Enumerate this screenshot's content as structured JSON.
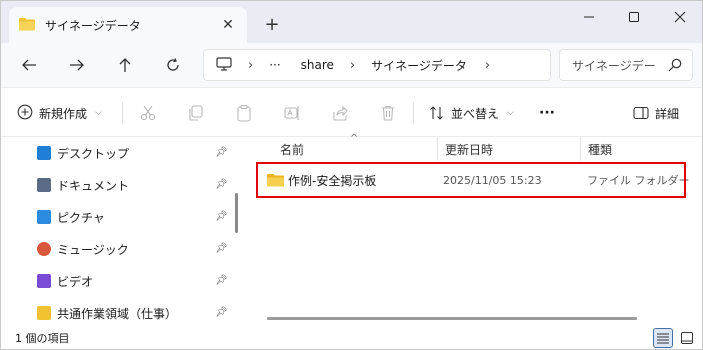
{
  "tab": {
    "title": "サイネージデータ",
    "close": "✕",
    "new_tab": "+"
  },
  "window_controls": {
    "minimize": "—",
    "maximize": "☐",
    "close": "✕"
  },
  "address": {
    "ellipsis": "···",
    "crumbs": [
      "share",
      "サイネージデータ"
    ]
  },
  "search": {
    "placeholder": "サイネージデー"
  },
  "commands": {
    "new_label": "新規作成",
    "sort_label": "並べ替え",
    "more": "···",
    "details_label": "詳細"
  },
  "sidebar": {
    "items": [
      {
        "label": "デスクトップ",
        "icon": "desktop-icon",
        "color": "#1f7fd6"
      },
      {
        "label": "ドキュメント",
        "icon": "document-icon",
        "color": "#5b6b85"
      },
      {
        "label": "ピクチャ",
        "icon": "picture-icon",
        "color": "#2b8be0"
      },
      {
        "label": "ミュージック",
        "icon": "music-icon",
        "color": "#d9573b"
      },
      {
        "label": "ビデオ",
        "icon": "video-icon",
        "color": "#7a4bd6"
      },
      {
        "label": "共通作業領域（仕事）",
        "icon": "folder-icon",
        "color": "#f2c230"
      }
    ]
  },
  "columns": {
    "name": "名前",
    "modified": "更新日時",
    "type": "種類"
  },
  "files": [
    {
      "name": "作例-安全掲示板",
      "modified": "2025/11/05 15:23",
      "type": "ファイル フォルダー"
    }
  ],
  "status": {
    "count_text": "1 個の項目"
  },
  "colors": {
    "folder": "#f2c230",
    "highlight": "#e00000",
    "accent": "#4a6fa5"
  }
}
